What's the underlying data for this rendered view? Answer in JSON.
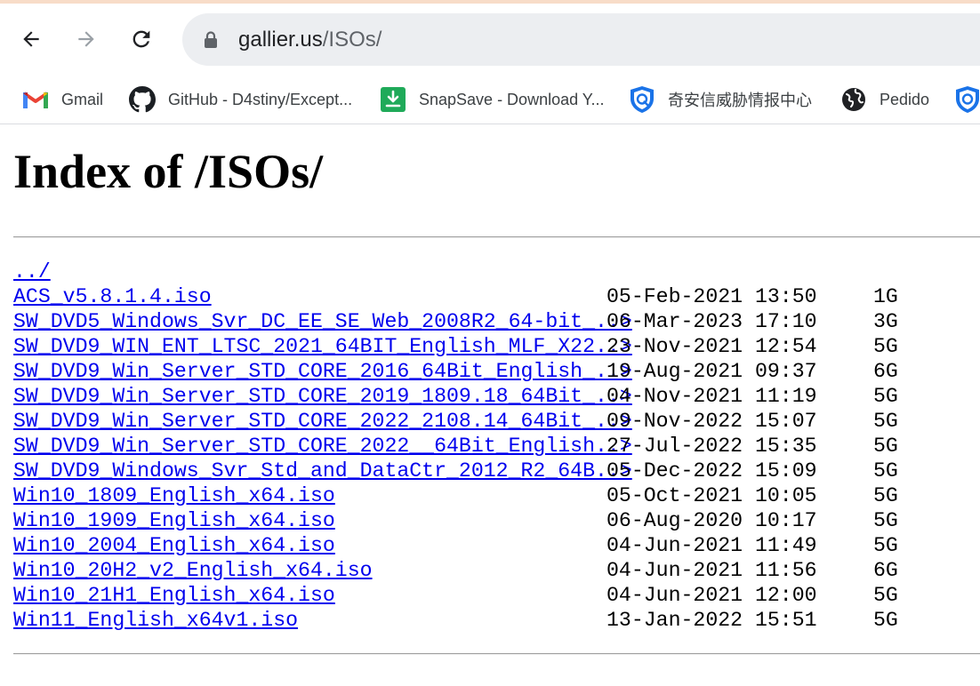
{
  "browser": {
    "url_host": "gallier.us",
    "url_path": "/ISOs/",
    "nav": {
      "back": "back-arrow-icon",
      "forward": "forward-arrow-icon",
      "reload": "reload-icon",
      "lock": "lock-icon"
    }
  },
  "bookmarks": [
    {
      "label": "Gmail",
      "icon": "gmail-icon"
    },
    {
      "label": "GitHub - D4stiny/Except...",
      "icon": "github-icon"
    },
    {
      "label": "SnapSave - Download Y...",
      "icon": "download-icon"
    },
    {
      "label": "奇安信威胁情报中心",
      "icon": "shield-icon"
    },
    {
      "label": "Pedido",
      "icon": "globe-icon"
    },
    {
      "label": "",
      "icon": "shield-icon"
    }
  ],
  "page": {
    "title": "Index of /ISOs/",
    "parent_link": "../",
    "files": [
      {
        "name": "ACS_v5.8.1.4.iso",
        "date": "05-Feb-2021 13:50",
        "size": "1G"
      },
      {
        "name": "SW_DVD5_Windows_Svr_DC_EE_SE_Web_2008R2_64-bit_..>",
        "date": "06-Mar-2023 17:10",
        "size": "3G"
      },
      {
        "name": "SW_DVD9_WIN_ENT_LTSC_2021_64BIT_English_MLF_X22..>",
        "date": "23-Nov-2021 12:54",
        "size": "5G"
      },
      {
        "name": "SW_DVD9_Win_Server_STD_CORE_2016_64Bit_English_..>",
        "date": "19-Aug-2021 09:37",
        "size": "6G"
      },
      {
        "name": "SW_DVD9_Win_Server_STD_CORE_2019_1809.18_64Bit_..>",
        "date": "04-Nov-2021 11:19",
        "size": "5G"
      },
      {
        "name": "SW_DVD9_Win_Server_STD_CORE_2022_2108.14_64Bit_..>",
        "date": "09-Nov-2022 15:07",
        "size": "5G"
      },
      {
        "name": "SW_DVD9_Win_Server_STD_CORE_2022__64Bit_English..>",
        "date": "27-Jul-2022 15:35",
        "size": "5G"
      },
      {
        "name": "SW_DVD9_Windows_Svr_Std_and_DataCtr_2012_R2_64B..>",
        "date": "05-Dec-2022 15:09",
        "size": "5G"
      },
      {
        "name": "Win10_1809_English_x64.iso",
        "date": "05-Oct-2021 10:05",
        "size": "5G"
      },
      {
        "name": "Win10_1909_English_x64.iso",
        "date": "06-Aug-2020 10:17",
        "size": "5G"
      },
      {
        "name": "Win10_2004_English_x64.iso",
        "date": "04-Jun-2021 11:49",
        "size": "5G"
      },
      {
        "name": "Win10_20H2_v2_English_x64.iso",
        "date": "04-Jun-2021 11:56",
        "size": "6G"
      },
      {
        "name": "Win10_21H1_English_x64.iso",
        "date": "04-Jun-2021 12:00",
        "size": "5G"
      },
      {
        "name": "Win11_English_x64v1.iso",
        "date": "13-Jan-2022 15:51",
        "size": "5G"
      }
    ]
  },
  "colors": {
    "link": "#0000ee",
    "omnibox": "#eceef1",
    "top_strip": "#f8dcc8"
  }
}
